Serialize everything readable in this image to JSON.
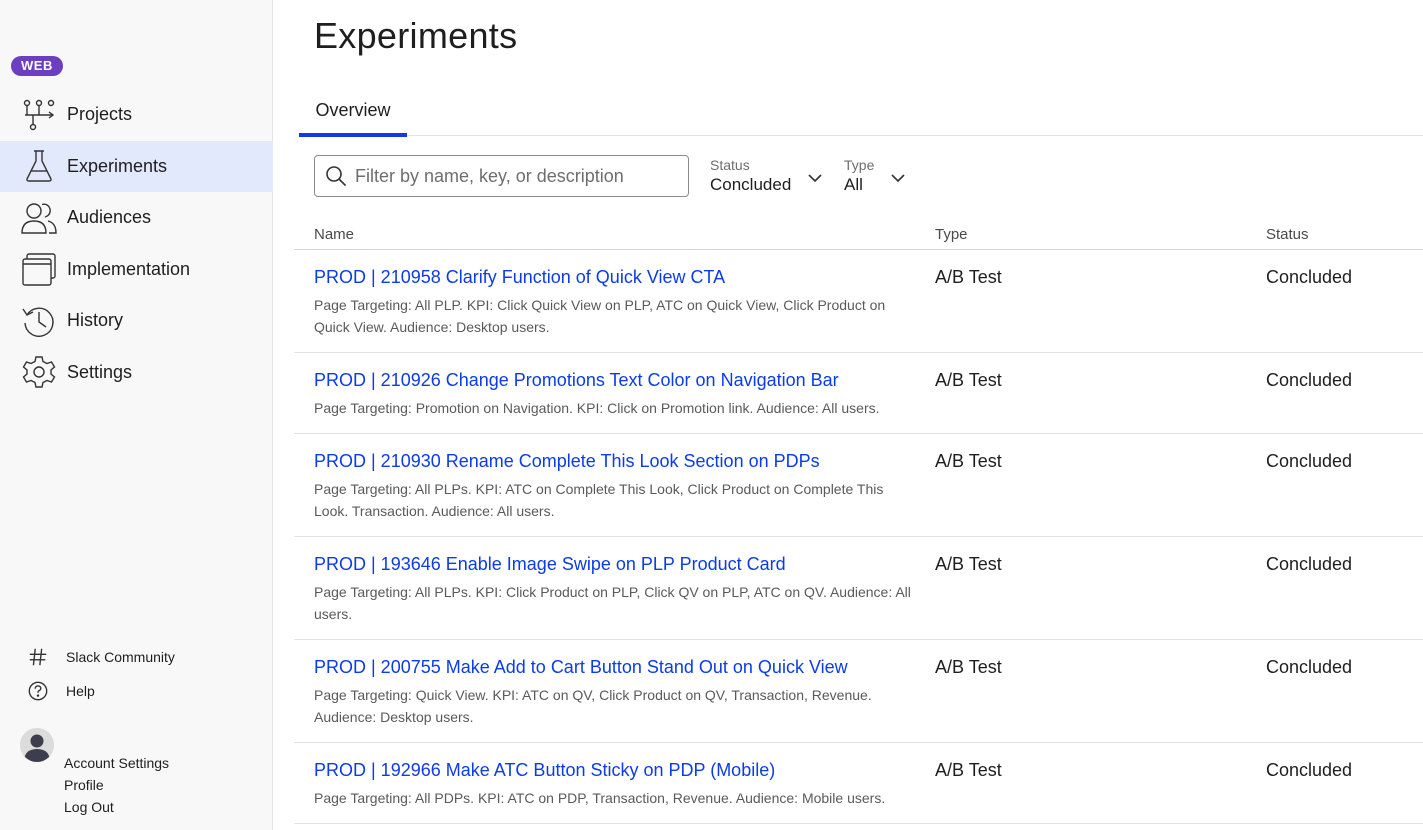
{
  "sidebar": {
    "badge": "WEB",
    "nav": [
      {
        "label": "Projects",
        "icon": "projects-icon"
      },
      {
        "label": "Experiments",
        "icon": "flask-icon",
        "active": true
      },
      {
        "label": "Audiences",
        "icon": "users-icon"
      },
      {
        "label": "Implementation",
        "icon": "window-icon"
      },
      {
        "label": "History",
        "icon": "history-icon"
      },
      {
        "label": "Settings",
        "icon": "gear-icon"
      }
    ],
    "footer": {
      "slack": "Slack Community",
      "help": "Help"
    },
    "account": {
      "settings": "Account Settings",
      "profile": "Profile",
      "logout": "Log Out"
    }
  },
  "main": {
    "title": "Experiments",
    "tabs": [
      {
        "label": "Overview",
        "active": true
      }
    ],
    "search": {
      "placeholder": "Filter by name, key, or description",
      "value": ""
    },
    "filters": {
      "status": {
        "label": "Status",
        "value": "Concluded"
      },
      "type": {
        "label": "Type",
        "value": "All"
      }
    },
    "table": {
      "columns": [
        "Name",
        "Type",
        "Status"
      ],
      "rows": [
        {
          "name": "PROD | 210958 Clarify Function of Quick View CTA",
          "description": "Page Targeting: All PLP. KPI: Click Quick View on PLP, ATC on Quick View, Click Product on Quick View. Audience: Desktop users.",
          "type": "A/B Test",
          "status": "Concluded"
        },
        {
          "name": "PROD | 210926 Change Promotions Text Color on Navigation Bar",
          "description": "Page Targeting: Promotion on Navigation. KPI: Click on Promotion link. Audience: All users.",
          "type": "A/B Test",
          "status": "Concluded"
        },
        {
          "name": "PROD | 210930 Rename Complete This Look Section on PDPs",
          "description": "Page Targeting: All PLPs. KPI: ATC on Complete This Look, Click Product on Complete This Look. Transaction. Audience: All users.",
          "type": "A/B Test",
          "status": "Concluded"
        },
        {
          "name": "PROD | 193646 Enable Image Swipe on PLP Product Card",
          "description": "Page Targeting: All PLPs. KPI: Click Product on PLP, Click QV on PLP, ATC on QV. Audience: All users.",
          "type": "A/B Test",
          "status": "Concluded"
        },
        {
          "name": "PROD | 200755 Make Add to Cart Button Stand Out on Quick View",
          "description": "Page Targeting: Quick View. KPI: ATC on QV, Click Product on QV, Transaction, Revenue. Audience: Desktop users.",
          "type": "A/B Test",
          "status": "Concluded"
        },
        {
          "name": "PROD | 192966 Make ATC Button Sticky on PDP (Mobile)",
          "description": "Page Targeting: All PDPs. KPI: ATC on PDP, Transaction, Revenue. Audience: Mobile users.",
          "type": "A/B Test",
          "status": "Concluded"
        }
      ]
    }
  },
  "colors": {
    "accent": "#0b3ce8",
    "badge": "#6b3fc0",
    "active_nav": "#e3e9fc"
  }
}
